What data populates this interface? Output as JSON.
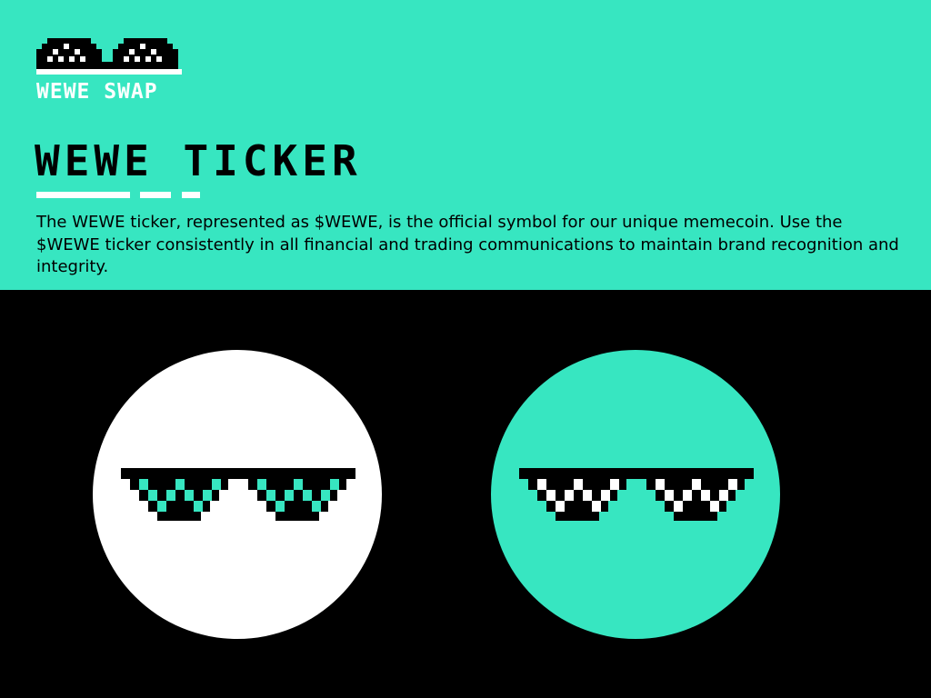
{
  "brand": {
    "name": "WEWE SWAP",
    "logo_icon": "pixel-sunglasses-icon"
  },
  "section": {
    "title": "WEWE TICKER",
    "description": "The WEWE ticker, represented as $WEWE, is the official symbol for our unique memecoin. Use the $WEWE ticker consistently in all financial and trading communications to maintain brand recognition and integrity."
  },
  "variants": [
    {
      "icon": "pixel-sunglasses-icon",
      "background": "#ffffff",
      "frame": "#000000",
      "lenses": "#37e6c1"
    },
    {
      "icon": "pixel-sunglasses-icon",
      "background": "#37e6c1",
      "frame": "#000000",
      "lenses": "#ffffff"
    }
  ],
  "colors": {
    "accent": "#37e6c1",
    "dark": "#000000",
    "light": "#ffffff"
  }
}
